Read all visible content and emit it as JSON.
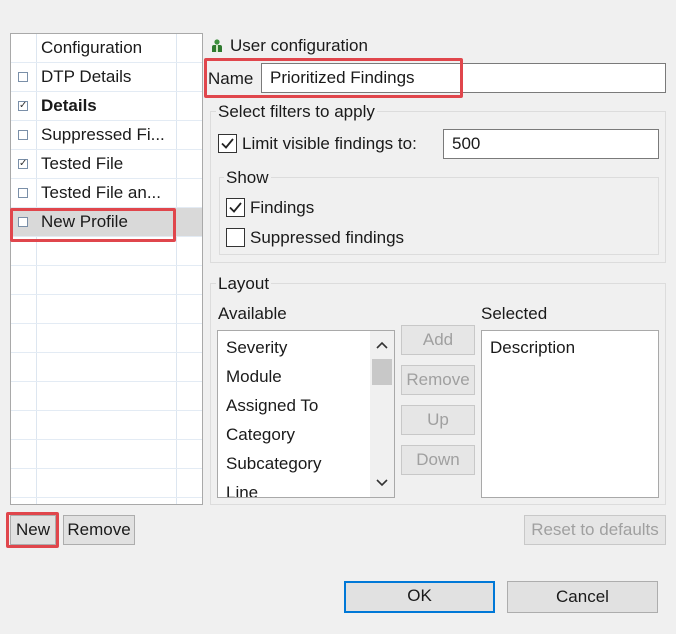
{
  "profiles": {
    "header": "Configuration",
    "items": [
      {
        "label": "DTP Details",
        "checked": false,
        "bold": false,
        "selected": false
      },
      {
        "label": "Details",
        "checked": true,
        "bold": true,
        "selected": false
      },
      {
        "label": "Suppressed Fi...",
        "checked": false,
        "bold": false,
        "selected": false
      },
      {
        "label": "Tested File",
        "checked": true,
        "bold": false,
        "selected": false
      },
      {
        "label": "Tested File an...",
        "checked": false,
        "bold": false,
        "selected": false
      },
      {
        "label": "New Profile",
        "checked": false,
        "bold": false,
        "selected": true
      }
    ],
    "new_label": "New",
    "remove_label": "Remove"
  },
  "config": {
    "scope_label": "User configuration",
    "name_label": "Name",
    "name_value": "Prioritized Findings"
  },
  "filters": {
    "title": "Select filters to apply",
    "limit_label": "Limit visible findings to:",
    "limit_checked": true,
    "limit_value": "500",
    "show_title": "Show",
    "findings_label": "Findings",
    "findings_checked": true,
    "suppressed_label": "Suppressed findings",
    "suppressed_checked": false
  },
  "layout": {
    "title": "Layout",
    "available_label": "Available",
    "selected_label": "Selected",
    "available": [
      "Severity",
      "Module",
      "Assigned To",
      "Category",
      "Subcategory",
      "Line"
    ],
    "selected": [
      "Description"
    ],
    "add_label": "Add",
    "remove_label": "Remove",
    "up_label": "Up",
    "down_label": "Down",
    "reset_label": "Reset to defaults"
  },
  "dialog": {
    "ok_label": "OK",
    "cancel_label": "Cancel"
  },
  "colors": {
    "highlight": "#e0464c",
    "default_button_border": "#0078d7"
  }
}
